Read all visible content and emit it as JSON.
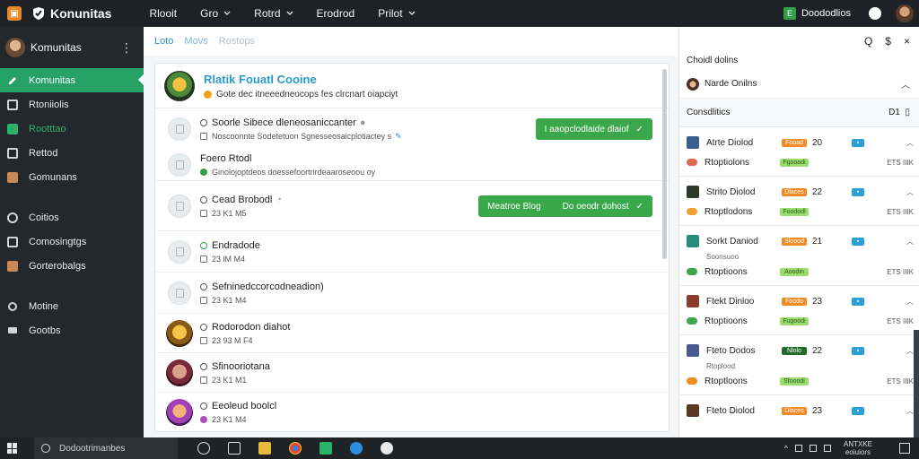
{
  "topbar": {
    "brand": "Konunitas",
    "nav": [
      "Rlooit",
      "Gro",
      "Rotrd",
      "Erodrod",
      "Prilot"
    ],
    "user": "Doododlios"
  },
  "sidebar": {
    "header": "Komunitas",
    "menu_icon": "⋮",
    "items": [
      {
        "label": "Komunitas",
        "icon": "pencil-icon",
        "active": true
      },
      {
        "label": "Rtoniiolis",
        "icon": "square-icon"
      },
      {
        "label": "Rootttao",
        "icon": "square-icon-green"
      },
      {
        "label": "Rettod",
        "icon": "square-icon"
      },
      {
        "label": "Gomunans",
        "icon": "person-icon"
      },
      {
        "label": "Coitios",
        "icon": "circle-icon"
      },
      {
        "label": "Comosingtgs",
        "icon": "list-icon"
      },
      {
        "label": "Gorterobalgs",
        "icon": "person-icon"
      },
      {
        "label": "Motine",
        "icon": "gear-icon"
      },
      {
        "label": "Gootbs",
        "icon": "chat-icon"
      }
    ]
  },
  "main": {
    "tabs": [
      "Loto",
      "Movs",
      "Rostops"
    ],
    "card": {
      "title": "Rlatik Fouatl Cooine",
      "subtitle": "Gote dec itneeedneocops fes clrcnart oiapciyt"
    },
    "rows": [
      {
        "title": "Soorle Sibece dleneosaniccanter",
        "meta": "Noscoonnte Sodetetuon Sgnesseosaicplotiactey s",
        "button": "I aaopclodlaide dlaiof",
        "check": "✓"
      },
      {
        "title": "Foero Rtodl",
        "meta": "Ginolojoptdeos doessefoortrirdeaaroseoou oy"
      },
      {
        "title": "Cead Brobodl",
        "meta": "23 K1 M5",
        "button": "Meatroe Blog",
        "button_sub": "Do oeodr dohost",
        "check": "✓"
      },
      {
        "title": "Endradode",
        "meta": "23 lM M4"
      },
      {
        "title": "Sefninedccorcodneadion)",
        "meta": "23 K1 M4"
      },
      {
        "title": "Rodorodon diahot",
        "meta": "23 93 M F4"
      },
      {
        "title": "Sfinooriotana",
        "meta": "23 K1 M1"
      },
      {
        "title": "Eeoleud boolcl",
        "meta": "23 K1 M4"
      }
    ]
  },
  "right": {
    "toolbar": {
      "search": "Q",
      "amount": "$",
      "close": "×"
    },
    "section_title": "Choidl dolins",
    "profile": "Narde Onilns",
    "group_header": "Consdlitics",
    "group_count": "D1",
    "rows": [
      {
        "name": "Atrte Diolod",
        "tag": "Fooad",
        "num": "20",
        "sub": "Rtoptiolons",
        "tag2": "Fgooadi",
        "right": "ETS IIIK"
      },
      {
        "name": "Strito Diolod",
        "tag": "Dlaces",
        "num": "22",
        "sub": "Rtoptlodons",
        "tag2": "Foododl",
        "right": "ETS IIIK"
      },
      {
        "name": "Sorkt Daniod",
        "tag": "Sloood",
        "num": "21",
        "sub": "Rtoptioons",
        "sub_top": "Soonsuoo",
        "tag2": "Aoodin",
        "right": "ETS IIIK"
      },
      {
        "name": "Ftekt Dinloo",
        "tag": "Foodo",
        "num": "23",
        "sub": "Rtoptioons",
        "tag2": "Fugoodi",
        "right": "ETS IIIK"
      },
      {
        "name": "Fteto Dodos",
        "tag": "Nlolo",
        "num": "22",
        "sub": "Rtoptloons",
        "sub_top": "Rtoplood",
        "tag2": "Sfooodi",
        "right": "ETS IIIK"
      },
      {
        "name": "Fteto Diolod",
        "tag": "Dlaces",
        "num": "23",
        "sub": "",
        "tag2": "",
        "right": ""
      }
    ]
  },
  "taskbar": {
    "search": "Dodootrimanbes",
    "clock_top": "ANTXKE",
    "clock_bottom": "eoiuiors"
  }
}
